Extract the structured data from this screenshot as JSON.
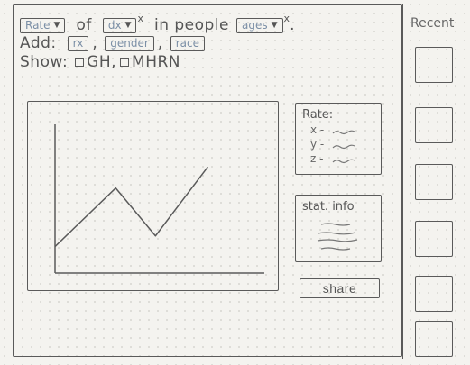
{
  "query": {
    "rate_select": "Rate",
    "of_text": "of",
    "dx_select": "dx",
    "in_people_text": "in people",
    "ages_select": "ages",
    "remove_mark": "x",
    "end_period": "."
  },
  "add_row": {
    "label": "Add:",
    "chips": [
      "rx",
      "gender",
      "race"
    ],
    "separator": ","
  },
  "show_row": {
    "label": "Show:",
    "options": [
      "GH",
      "MHRN"
    ]
  },
  "chart_data": {
    "type": "line",
    "title": "",
    "xlabel": "",
    "ylabel": "",
    "series": [
      {
        "values": [
          {
            "x": 0,
            "y": 0.25
          },
          {
            "x": 0.29,
            "y": 0.8
          },
          {
            "x": 0.48,
            "y": 0.35
          },
          {
            "x": 0.73,
            "y": 1.0
          }
        ]
      }
    ],
    "xlim": [
      0,
      1
    ],
    "ylim": [
      0,
      1.4
    ],
    "grid": false
  },
  "legend_card": {
    "title": "Rate:",
    "items": [
      "x -",
      "y -",
      "z -"
    ]
  },
  "stat_card": {
    "title": "stat. info"
  },
  "share_button": "share",
  "sidebar": {
    "title": "Recent",
    "thumb_count": 6
  }
}
